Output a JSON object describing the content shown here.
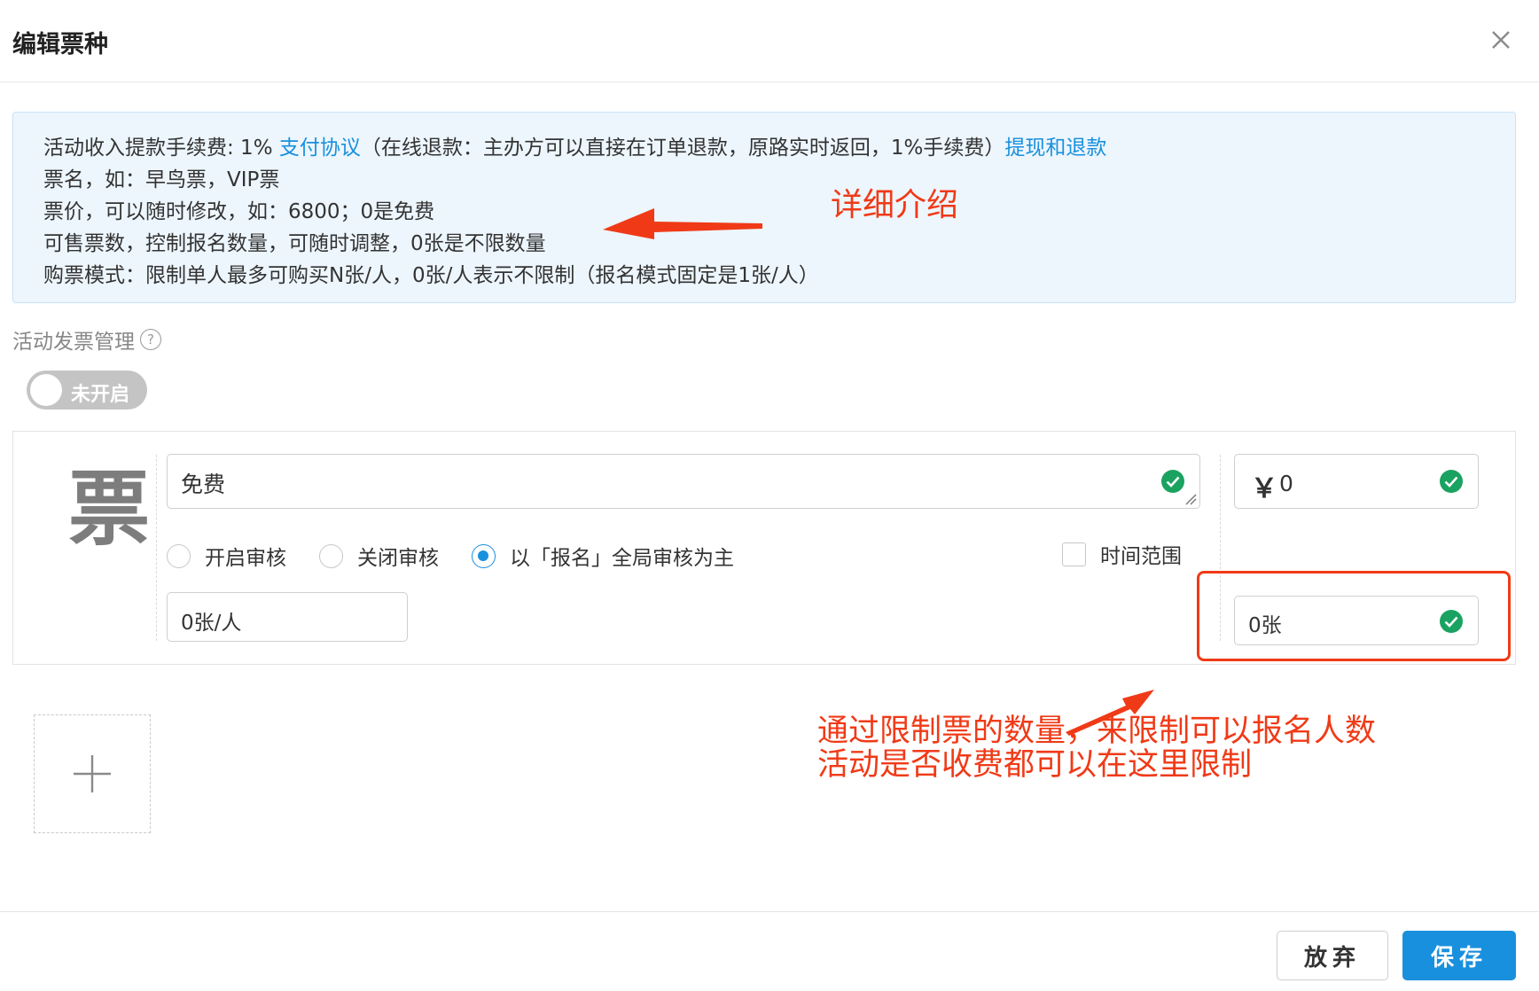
{
  "dialog": {
    "title": "编辑票种",
    "close_icon": "close-icon"
  },
  "info": {
    "line1_prefix": "活动收入提款手续费: 1% ",
    "line1_link1": "支付协议",
    "line1_middle": "（在线退款：主办方可以直接在订单退款，原路实时返回，1%手续费）",
    "line1_link2": "提现和退款",
    "line2": "票名，如：早鸟票，VIP票",
    "line3": "票价，可以随时修改，如：6800；0是免费",
    "line4": "可售票数，控制报名数量，可随时调整，0张是不限数量",
    "line5": "购票模式：限制单人最多可购买N张/人，0张/人表示不限制（报名模式固定是1张/人）"
  },
  "annotations": {
    "detail": "详细介绍",
    "limit_line1": "通过限制票的数量，来限制可以报名人数",
    "limit_line2": "活动是否收费都可以在这里限制"
  },
  "invoice": {
    "label": "活动发票管理",
    "help": "?",
    "toggle_label": "未开启",
    "toggle_on": false
  },
  "ticket": {
    "glyph": "票",
    "name_value": "免费",
    "price_symbol": "￥",
    "price_value": "0",
    "per_person_value": "0张/人",
    "quantity_value": "0张",
    "review_options": [
      {
        "label": "开启审核",
        "checked": false
      },
      {
        "label": "关闭审核",
        "checked": false
      },
      {
        "label": "以「报名」全局审核为主",
        "checked": true
      }
    ],
    "time_range_label": "时间范围",
    "time_range_checked": false
  },
  "colors": {
    "accent": "#1990dd",
    "annotation": "#f03a17",
    "success": "#1aa260",
    "info_bg": "#edf6fd"
  },
  "buttons": {
    "cancel": "放弃",
    "save": "保存"
  }
}
